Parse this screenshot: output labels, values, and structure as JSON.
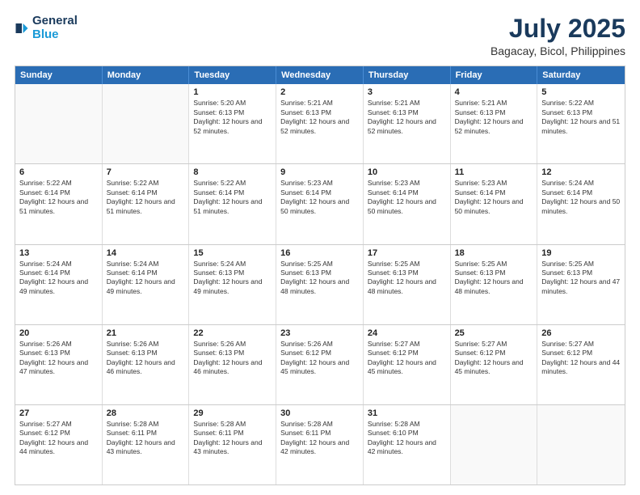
{
  "logo": {
    "line1": "General",
    "line2": "Blue",
    "icon": "▶"
  },
  "header": {
    "month_year": "July 2025",
    "location": "Bagacay, Bicol, Philippines"
  },
  "weekdays": [
    "Sunday",
    "Monday",
    "Tuesday",
    "Wednesday",
    "Thursday",
    "Friday",
    "Saturday"
  ],
  "rows": [
    [
      {
        "day": "",
        "sunrise": "",
        "sunset": "",
        "daylight": "",
        "empty": true
      },
      {
        "day": "",
        "sunrise": "",
        "sunset": "",
        "daylight": "",
        "empty": true
      },
      {
        "day": "1",
        "sunrise": "Sunrise: 5:20 AM",
        "sunset": "Sunset: 6:13 PM",
        "daylight": "Daylight: 12 hours and 52 minutes."
      },
      {
        "day": "2",
        "sunrise": "Sunrise: 5:21 AM",
        "sunset": "Sunset: 6:13 PM",
        "daylight": "Daylight: 12 hours and 52 minutes."
      },
      {
        "day": "3",
        "sunrise": "Sunrise: 5:21 AM",
        "sunset": "Sunset: 6:13 PM",
        "daylight": "Daylight: 12 hours and 52 minutes."
      },
      {
        "day": "4",
        "sunrise": "Sunrise: 5:21 AM",
        "sunset": "Sunset: 6:13 PM",
        "daylight": "Daylight: 12 hours and 52 minutes."
      },
      {
        "day": "5",
        "sunrise": "Sunrise: 5:22 AM",
        "sunset": "Sunset: 6:13 PM",
        "daylight": "Daylight: 12 hours and 51 minutes."
      }
    ],
    [
      {
        "day": "6",
        "sunrise": "Sunrise: 5:22 AM",
        "sunset": "Sunset: 6:14 PM",
        "daylight": "Daylight: 12 hours and 51 minutes."
      },
      {
        "day": "7",
        "sunrise": "Sunrise: 5:22 AM",
        "sunset": "Sunset: 6:14 PM",
        "daylight": "Daylight: 12 hours and 51 minutes."
      },
      {
        "day": "8",
        "sunrise": "Sunrise: 5:22 AM",
        "sunset": "Sunset: 6:14 PM",
        "daylight": "Daylight: 12 hours and 51 minutes."
      },
      {
        "day": "9",
        "sunrise": "Sunrise: 5:23 AM",
        "sunset": "Sunset: 6:14 PM",
        "daylight": "Daylight: 12 hours and 50 minutes."
      },
      {
        "day": "10",
        "sunrise": "Sunrise: 5:23 AM",
        "sunset": "Sunset: 6:14 PM",
        "daylight": "Daylight: 12 hours and 50 minutes."
      },
      {
        "day": "11",
        "sunrise": "Sunrise: 5:23 AM",
        "sunset": "Sunset: 6:14 PM",
        "daylight": "Daylight: 12 hours and 50 minutes."
      },
      {
        "day": "12",
        "sunrise": "Sunrise: 5:24 AM",
        "sunset": "Sunset: 6:14 PM",
        "daylight": "Daylight: 12 hours and 50 minutes."
      }
    ],
    [
      {
        "day": "13",
        "sunrise": "Sunrise: 5:24 AM",
        "sunset": "Sunset: 6:14 PM",
        "daylight": "Daylight: 12 hours and 49 minutes."
      },
      {
        "day": "14",
        "sunrise": "Sunrise: 5:24 AM",
        "sunset": "Sunset: 6:14 PM",
        "daylight": "Daylight: 12 hours and 49 minutes."
      },
      {
        "day": "15",
        "sunrise": "Sunrise: 5:24 AM",
        "sunset": "Sunset: 6:13 PM",
        "daylight": "Daylight: 12 hours and 49 minutes."
      },
      {
        "day": "16",
        "sunrise": "Sunrise: 5:25 AM",
        "sunset": "Sunset: 6:13 PM",
        "daylight": "Daylight: 12 hours and 48 minutes."
      },
      {
        "day": "17",
        "sunrise": "Sunrise: 5:25 AM",
        "sunset": "Sunset: 6:13 PM",
        "daylight": "Daylight: 12 hours and 48 minutes."
      },
      {
        "day": "18",
        "sunrise": "Sunrise: 5:25 AM",
        "sunset": "Sunset: 6:13 PM",
        "daylight": "Daylight: 12 hours and 48 minutes."
      },
      {
        "day": "19",
        "sunrise": "Sunrise: 5:25 AM",
        "sunset": "Sunset: 6:13 PM",
        "daylight": "Daylight: 12 hours and 47 minutes."
      }
    ],
    [
      {
        "day": "20",
        "sunrise": "Sunrise: 5:26 AM",
        "sunset": "Sunset: 6:13 PM",
        "daylight": "Daylight: 12 hours and 47 minutes."
      },
      {
        "day": "21",
        "sunrise": "Sunrise: 5:26 AM",
        "sunset": "Sunset: 6:13 PM",
        "daylight": "Daylight: 12 hours and 46 minutes."
      },
      {
        "day": "22",
        "sunrise": "Sunrise: 5:26 AM",
        "sunset": "Sunset: 6:13 PM",
        "daylight": "Daylight: 12 hours and 46 minutes."
      },
      {
        "day": "23",
        "sunrise": "Sunrise: 5:26 AM",
        "sunset": "Sunset: 6:12 PM",
        "daylight": "Daylight: 12 hours and 45 minutes."
      },
      {
        "day": "24",
        "sunrise": "Sunrise: 5:27 AM",
        "sunset": "Sunset: 6:12 PM",
        "daylight": "Daylight: 12 hours and 45 minutes."
      },
      {
        "day": "25",
        "sunrise": "Sunrise: 5:27 AM",
        "sunset": "Sunset: 6:12 PM",
        "daylight": "Daylight: 12 hours and 45 minutes."
      },
      {
        "day": "26",
        "sunrise": "Sunrise: 5:27 AM",
        "sunset": "Sunset: 6:12 PM",
        "daylight": "Daylight: 12 hours and 44 minutes."
      }
    ],
    [
      {
        "day": "27",
        "sunrise": "Sunrise: 5:27 AM",
        "sunset": "Sunset: 6:12 PM",
        "daylight": "Daylight: 12 hours and 44 minutes."
      },
      {
        "day": "28",
        "sunrise": "Sunrise: 5:28 AM",
        "sunset": "Sunset: 6:11 PM",
        "daylight": "Daylight: 12 hours and 43 minutes."
      },
      {
        "day": "29",
        "sunrise": "Sunrise: 5:28 AM",
        "sunset": "Sunset: 6:11 PM",
        "daylight": "Daylight: 12 hours and 43 minutes."
      },
      {
        "day": "30",
        "sunrise": "Sunrise: 5:28 AM",
        "sunset": "Sunset: 6:11 PM",
        "daylight": "Daylight: 12 hours and 42 minutes."
      },
      {
        "day": "31",
        "sunrise": "Sunrise: 5:28 AM",
        "sunset": "Sunset: 6:10 PM",
        "daylight": "Daylight: 12 hours and 42 minutes."
      },
      {
        "day": "",
        "sunrise": "",
        "sunset": "",
        "daylight": "",
        "empty": true
      },
      {
        "day": "",
        "sunrise": "",
        "sunset": "",
        "daylight": "",
        "empty": true
      }
    ]
  ]
}
